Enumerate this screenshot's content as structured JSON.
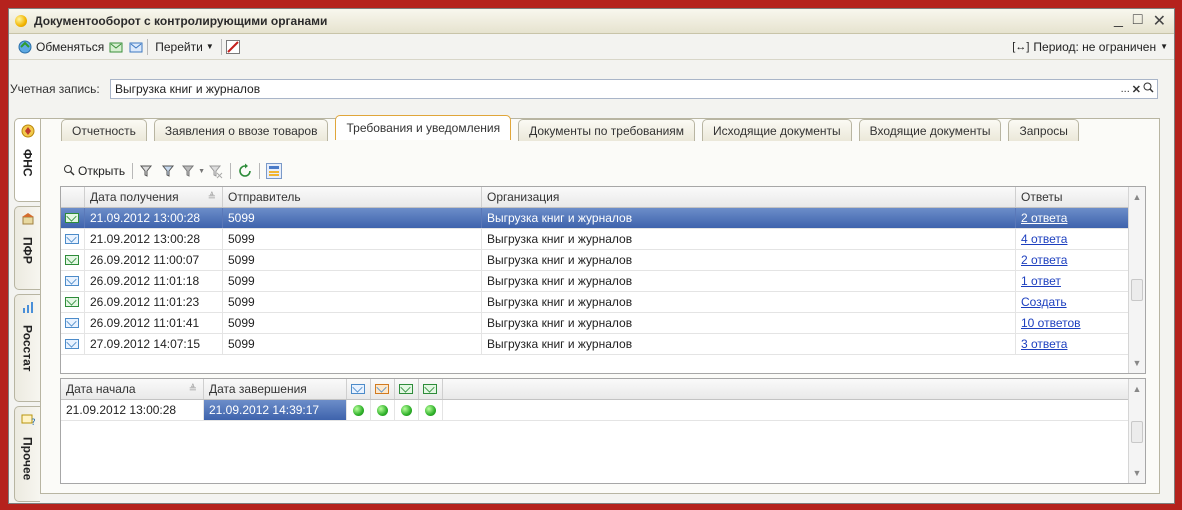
{
  "window": {
    "title": "Документооборот с контролирующими органами"
  },
  "toolbar": {
    "exchange_label": "Обменяться",
    "goto_label": "Перейти",
    "period_label": "Период: не ограничен"
  },
  "account": {
    "label": "Учетная запись:",
    "value": "Выгрузка книг и журналов"
  },
  "vtabs": [
    "ФНС",
    "ПФР",
    "Росстат",
    "Прочее"
  ],
  "tabs": [
    "Отчетность",
    "Заявления о ввозе товаров",
    "Требования и уведомления",
    "Документы по требованиям",
    "Исходящие документы",
    "Входящие документы",
    "Запросы"
  ],
  "inner_toolbar": {
    "open_label": "Открыть"
  },
  "grid1": {
    "headers": [
      "Дата получения",
      "Отправитель",
      "Организация",
      "Ответы"
    ],
    "rows": [
      {
        "date": "21.09.2012 13:00:28",
        "sender": "5099",
        "org": "Выгрузка книг и журналов",
        "answers": "2 ответа",
        "icon": "envelope-arrow-icon"
      },
      {
        "date": "21.09.2012 13:00:28",
        "sender": "5099",
        "org": "Выгрузка книг и журналов",
        "answers": "4 ответа",
        "icon": "envelope-icon"
      },
      {
        "date": "26.09.2012 11:00:07",
        "sender": "5099",
        "org": "Выгрузка книг и журналов",
        "answers": "2 ответа",
        "icon": "envelope-arrow-icon"
      },
      {
        "date": "26.09.2012 11:01:18",
        "sender": "5099",
        "org": "Выгрузка книг и журналов",
        "answers": "1 ответ",
        "icon": "envelope-icon"
      },
      {
        "date": "26.09.2012 11:01:23",
        "sender": "5099",
        "org": "Выгрузка книг и журналов",
        "answers": "Создать",
        "icon": "envelope-arrow-icon"
      },
      {
        "date": "26.09.2012 11:01:41",
        "sender": "5099",
        "org": "Выгрузка книг и журналов",
        "answers": "10 ответов",
        "icon": "envelope-icon"
      },
      {
        "date": "27.09.2012 14:07:15",
        "sender": "5099",
        "org": "Выгрузка книг и журналов",
        "answers": "3 ответа",
        "icon": "envelope-icon"
      }
    ]
  },
  "grid2": {
    "headers": [
      "Дата начала",
      "Дата завершения"
    ],
    "rows": [
      {
        "start": "21.09.2012 13:00:28",
        "end": "21.09.2012 14:39:17"
      }
    ]
  }
}
